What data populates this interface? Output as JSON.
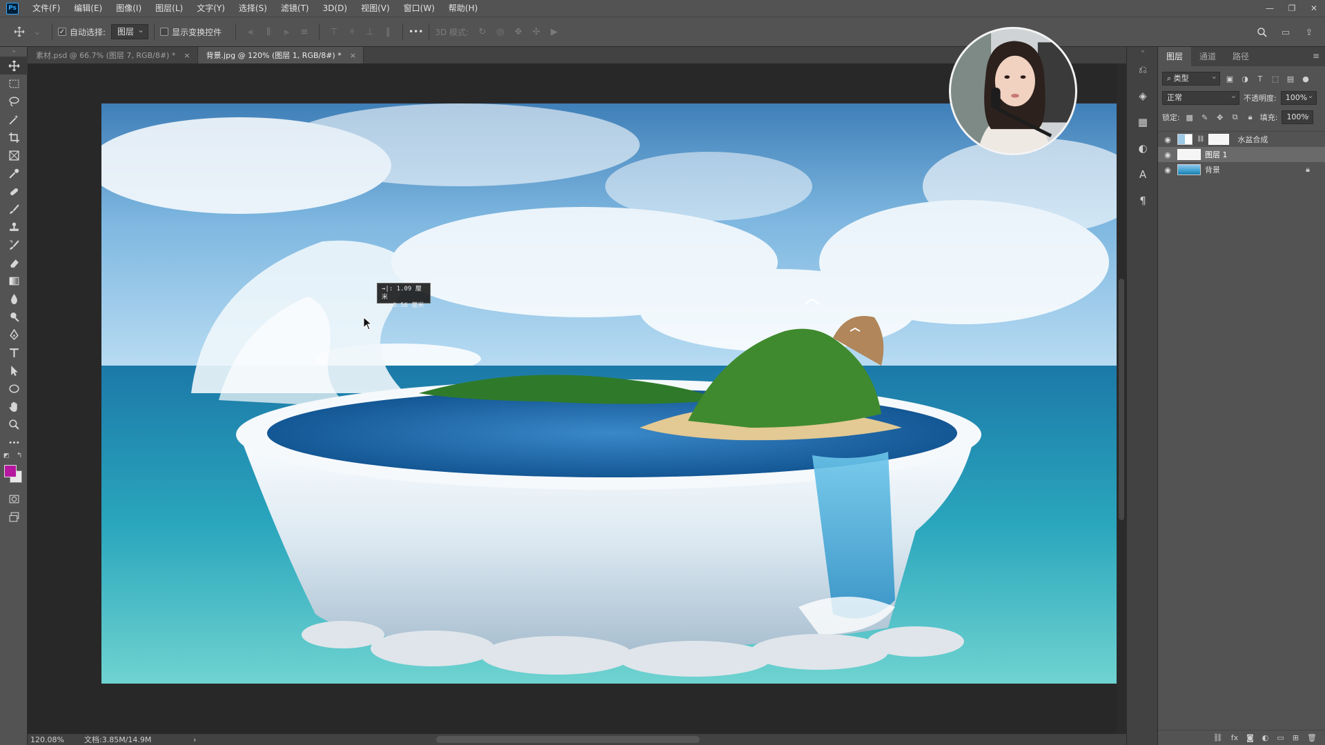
{
  "app": {
    "logo": "Ps"
  },
  "menu": [
    "文件(F)",
    "编辑(E)",
    "图像(I)",
    "图层(L)",
    "文字(Y)",
    "选择(S)",
    "滤镜(T)",
    "3D(D)",
    "视图(V)",
    "窗口(W)",
    "帮助(H)"
  ],
  "window_controls": {
    "minimize": "—",
    "restore": "❐",
    "close": "✕"
  },
  "options": {
    "auto_select_label": "自动选择:",
    "auto_select_checked": true,
    "auto_select_target": "图层",
    "show_transform_label": "显示变换控件",
    "show_transform_checked": false,
    "more_label": "•••",
    "mode_3d_label": "3D 模式:"
  },
  "tabs": [
    {
      "label": "素材.psd @ 66.7% (图层 7, RGB/8#) *",
      "active": false
    },
    {
      "label": "背景.jpg @ 120% (图层 1, RGB/8#) *",
      "active": true
    }
  ],
  "tab_close": "×",
  "colors": {
    "foreground": "#b5179e",
    "background": "#e8e8e8",
    "accent": "#31a8ff"
  },
  "canvas": {
    "tooltip_line1": "→|: 1.09 厘米",
    "tooltip_line2": "↓: 0.56 厘米"
  },
  "status": {
    "zoom": "120.08%",
    "doc_size": "文档:3.85M/14.9M",
    "arrow": "›"
  },
  "layers_panel": {
    "tabs": [
      "图层",
      "通道",
      "路径"
    ],
    "filter_kind": "类型",
    "blend_mode": "正常",
    "opacity_label": "不透明度:",
    "opacity_value": "100%",
    "lock_label": "锁定:",
    "fill_label": "填充:",
    "fill_value": "100%",
    "layers": [
      {
        "name": "水盆合成",
        "visible": true,
        "selected": false,
        "locked": false
      },
      {
        "name": "图层 1",
        "visible": true,
        "selected": true,
        "locked": false
      },
      {
        "name": "背景",
        "visible": true,
        "selected": false,
        "locked": true
      }
    ],
    "footer_icons": [
      "link-icon",
      "fx-icon",
      "mask-icon",
      "adjustment-icon",
      "folder-icon",
      "new-layer-icon",
      "trash-icon"
    ]
  }
}
